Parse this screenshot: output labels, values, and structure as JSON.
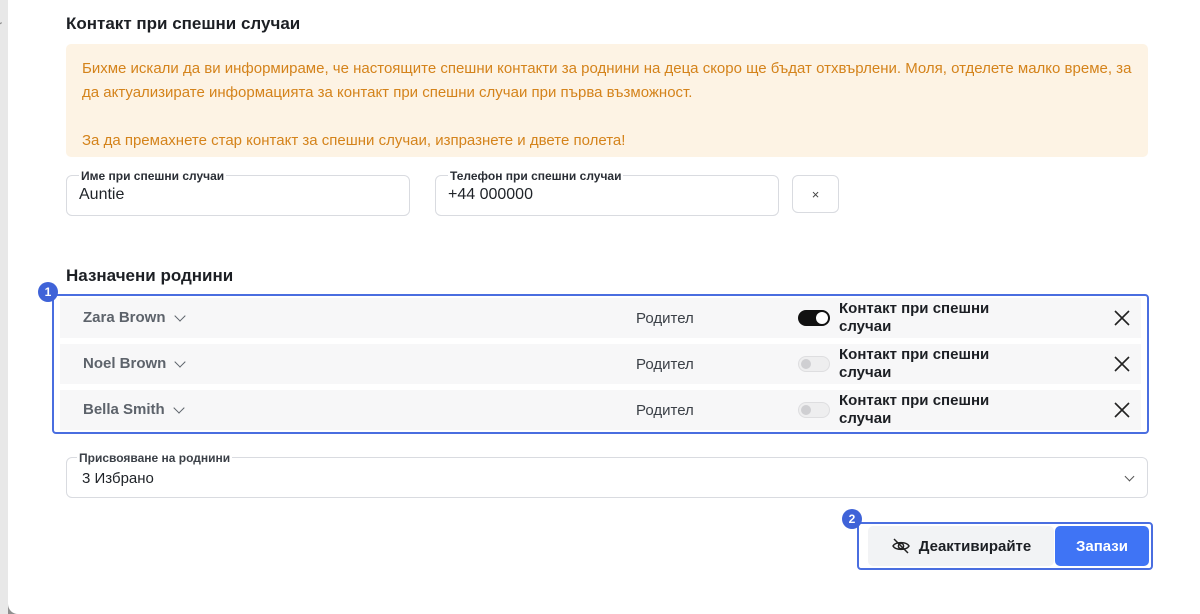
{
  "emergency": {
    "title": "Контакт при спешни случаи",
    "notice_line1": "Бихме искали да ви информираме, че настоящите спешни контакти за роднини на деца скоро ще бъдат отхвърлени. Моля, отделете малко време, за да актуализирате информацията за контакт при спешни случаи при първа възможност.",
    "notice_line2": "За да премахнете стар контакт за спешни случаи, изпразнете и двете полета!",
    "name_label": "Име при спешни случаи",
    "name_value": "Auntie",
    "phone_label": "Телефон при спешни случаи",
    "phone_value": "+44 000000",
    "clear_label": "×"
  },
  "relatives": {
    "title": "Назначени роднини",
    "marker": "1",
    "rows": [
      {
        "name": "Zara Brown",
        "role": "Родител",
        "emergency_label": "Контакт при спешни случаи",
        "emergency_contact": true
      },
      {
        "name": "Noel Brown",
        "role": "Родител",
        "emergency_label": "Контакт при спешни случаи",
        "emergency_contact": false
      },
      {
        "name": "Bella Smith",
        "role": "Родител",
        "emergency_label": "Контакт при спешни случаи",
        "emergency_contact": false
      }
    ]
  },
  "assign": {
    "label": "Присвояване на роднини",
    "value": "3 Избрано"
  },
  "actions": {
    "marker": "2",
    "deactivate_label": "Деактивирайте",
    "save_label": "Запази"
  },
  "colors": {
    "accent": "#3f74f5",
    "highlight_border": "#4a6ee0",
    "notice_bg": "#fdf3e4",
    "notice_text": "#d4831b"
  },
  "icons": {
    "deactivate": "eye-off-icon",
    "remove": "close-icon",
    "dropdown": "chevron-down-icon"
  }
}
